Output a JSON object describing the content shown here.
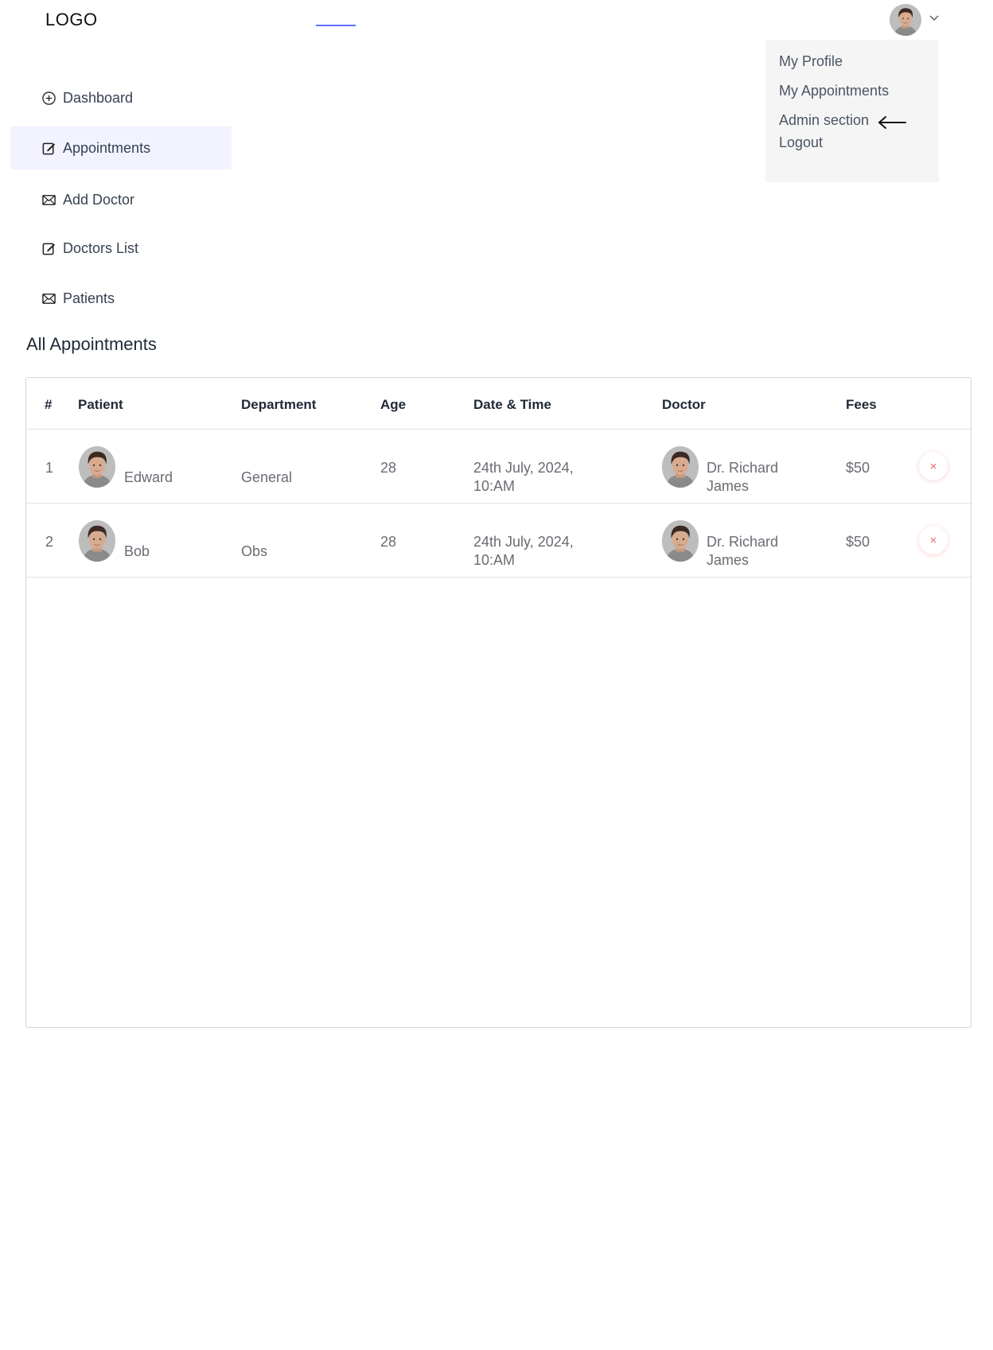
{
  "header": {
    "logo_text": "LOGO"
  },
  "dropdown": {
    "items": [
      "My Profile",
      "My Appointments",
      "Admin section",
      "Logout"
    ]
  },
  "sidebar": {
    "items": [
      {
        "label": "Dashboard",
        "icon": "plus-circle-icon",
        "active": false
      },
      {
        "label": "Appointments",
        "icon": "edit-note-icon",
        "active": true
      },
      {
        "label": "Add Doctor",
        "icon": "envelope-icon",
        "active": false
      },
      {
        "label": "Doctors List",
        "icon": "edit-note-icon",
        "active": false
      },
      {
        "label": "Patients",
        "icon": "envelope-icon",
        "active": false
      }
    ]
  },
  "main": {
    "title": "All Appointments",
    "columns": [
      "#",
      "Patient",
      "Department",
      "Age",
      "Date & Time",
      "Doctor",
      "Fees"
    ],
    "rows": [
      {
        "num": "1",
        "patient": "Edward",
        "department": "General",
        "age": "28",
        "datetime": "24th July, 2024, 10:AM",
        "doctor": "Dr. Richard James",
        "fees": "$50",
        "cancel": "×"
      },
      {
        "num": "2",
        "patient": "Bob",
        "department": "Obs",
        "age": "28",
        "datetime": "24th July, 2024, 10:AM",
        "doctor": "Dr. Richard James",
        "fees": "$50",
        "cancel": "×"
      }
    ]
  },
  "colors": {
    "accent": "#5f6fff",
    "active_bg": "#f2f3ff",
    "cancel": "#ef6b6b",
    "dropdown_bg": "#f5f5f6"
  }
}
